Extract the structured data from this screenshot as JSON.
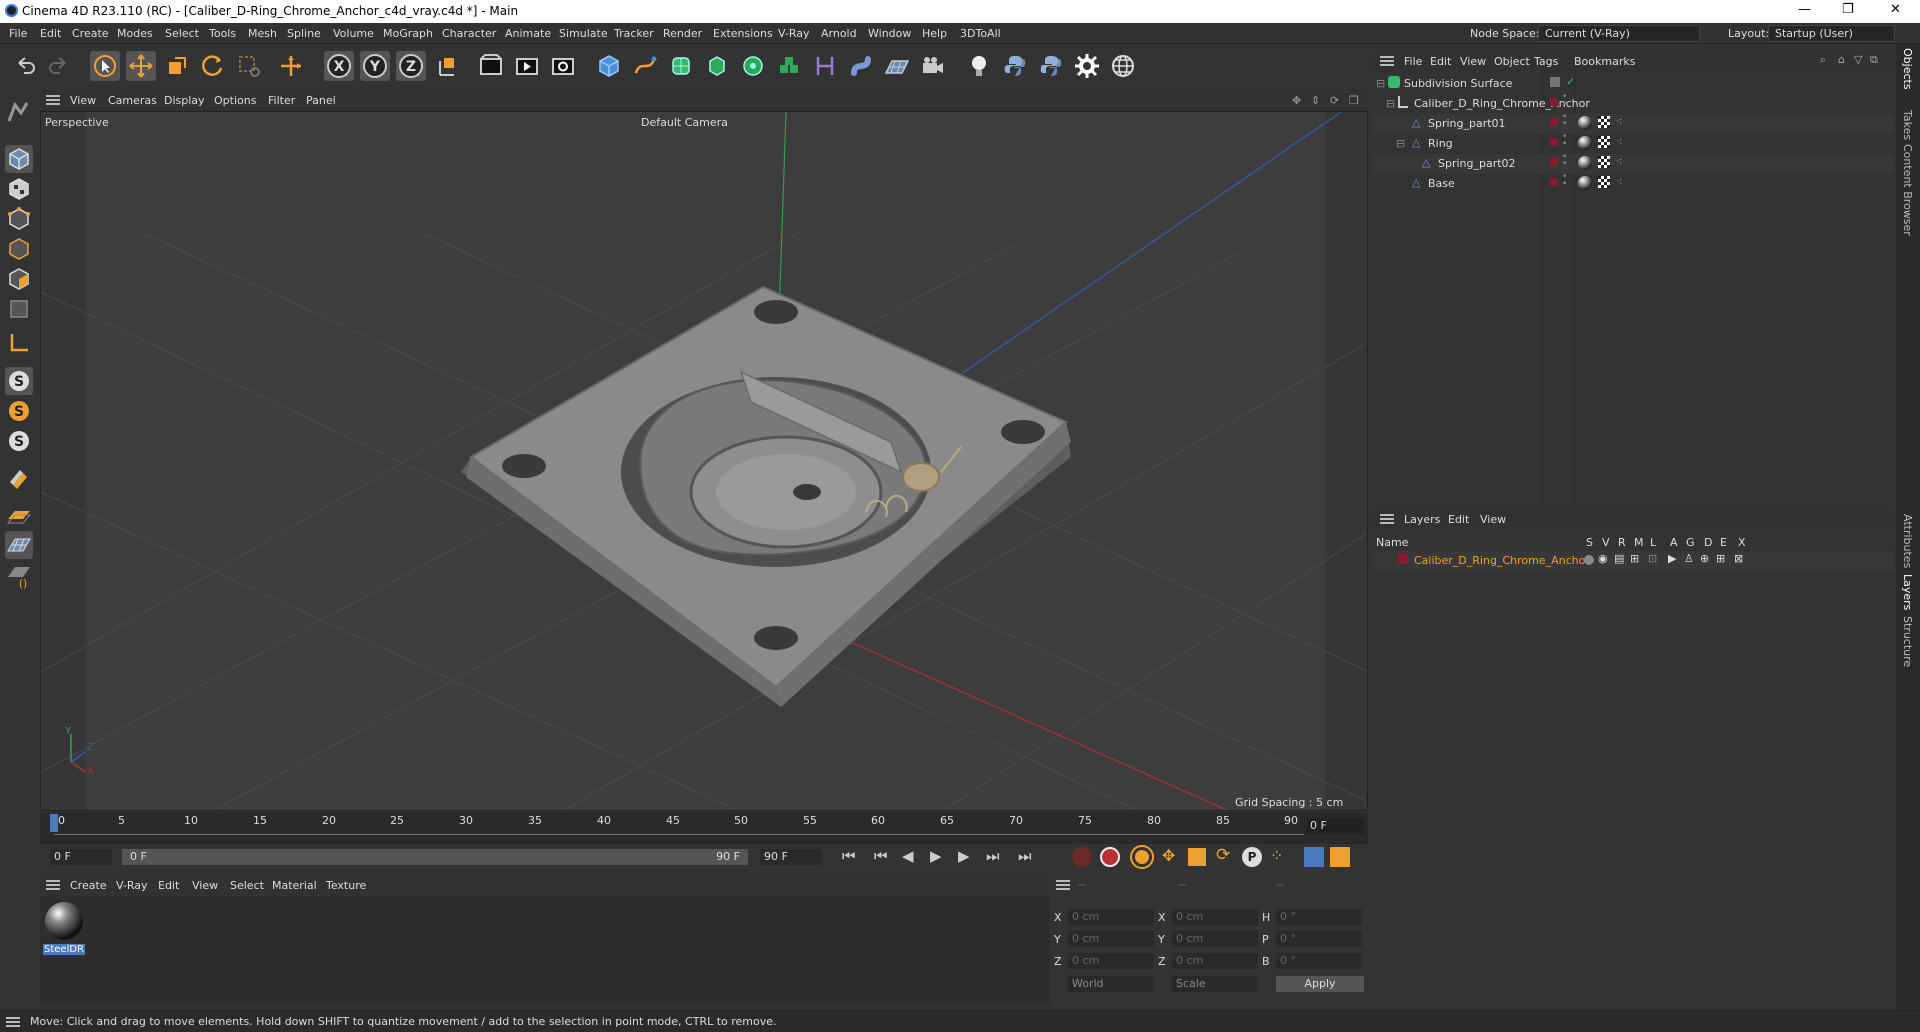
{
  "titlebar": {
    "title": "Cinema 4D R23.110 (RC) - [Caliber_D-Ring_Chrome_Anchor_c4d_vray.c4d *] - Main",
    "minimize": "—",
    "maximize": "❐",
    "close": "✕"
  },
  "menu": {
    "items": [
      "File",
      "Edit",
      "Create",
      "Modes",
      "Select",
      "Tools",
      "Mesh",
      "Spline",
      "Volume",
      "MoGraph",
      "Character",
      "Animate",
      "Simulate",
      "Tracker",
      "Render",
      "Extensions",
      "V-Ray",
      "Arnold",
      "Window",
      "Help",
      "3DToAll"
    ],
    "node_space_label": "Node Space:",
    "node_space_value": "Current (V-Ray)",
    "layout_label": "Layout:",
    "layout_value": "Startup (User)"
  },
  "viewport": {
    "menu": [
      "View",
      "Cameras",
      "Display",
      "Options",
      "Filter",
      "Panel"
    ],
    "view_name": "Perspective",
    "camera": "Default Camera",
    "grid_spacing": "Grid Spacing : 5 cm"
  },
  "timeline": {
    "ticks": [
      "0",
      "5",
      "10",
      "15",
      "20",
      "25",
      "30",
      "35",
      "40",
      "45",
      "50",
      "55",
      "60",
      "65",
      "70",
      "75",
      "80",
      "85",
      "90"
    ],
    "current": "0 F",
    "start": "0 F",
    "range_start": "0 F",
    "range_end": "90 F",
    "end": "90 F"
  },
  "material": {
    "menu": [
      "Create",
      "V-Ray",
      "Edit",
      "View",
      "Select",
      "Material",
      "Texture"
    ],
    "items": [
      {
        "name": "SteelDR"
      }
    ]
  },
  "coords": {
    "headers": [
      "--",
      "--",
      "--"
    ],
    "rows": [
      {
        "l1": "X",
        "v1": "0 cm",
        "l2": "X",
        "v2": "0 cm",
        "l3": "H",
        "v3": "0 °"
      },
      {
        "l1": "Y",
        "v1": "0 cm",
        "l2": "Y",
        "v2": "0 cm",
        "l3": "P",
        "v3": "0 °"
      },
      {
        "l1": "Z",
        "v1": "0 cm",
        "l2": "Z",
        "v2": "0 cm",
        "l3": "B",
        "v3": "0 °"
      }
    ],
    "world": "World",
    "scale": "Scale",
    "apply": "Apply"
  },
  "status": "Move: Click and drag to move elements. Hold down SHIFT to quantize movement / add to the selection in point mode, CTRL to remove.",
  "objects": {
    "menu": [
      "File",
      "Edit",
      "View",
      "Object",
      "Tags",
      "Bookmarks"
    ],
    "tree": [
      {
        "name": "Subdivision Surface"
      },
      {
        "name": "Caliber_D_Ring_Chrome_Anchor"
      },
      {
        "name": "Spring_part01"
      },
      {
        "name": "Ring"
      },
      {
        "name": "Spring_part02"
      },
      {
        "name": "Base"
      }
    ]
  },
  "layers": {
    "menu": [
      "Layers",
      "Edit",
      "View"
    ],
    "columns": {
      "name": "Name",
      "flags": [
        "S",
        "V",
        "R",
        "M",
        "L",
        "A",
        "G",
        "D",
        "E",
        "X"
      ]
    },
    "rows": [
      {
        "name": "Caliber_D_Ring_Chrome_Anchor",
        "color": "#8a1b2e"
      }
    ]
  },
  "sidetabs": [
    "Objects",
    "Takes",
    "Content Browser",
    "Attributes",
    "Layers",
    "Structure"
  ],
  "colors": {
    "accent": "#f0a030",
    "select_blue": "#4a7bbf",
    "layer_red": "#8a1b2e"
  }
}
